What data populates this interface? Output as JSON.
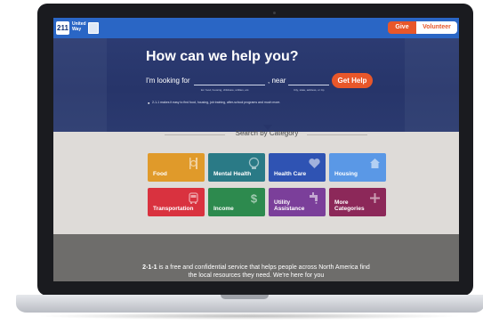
{
  "brand": {
    "logo_number": "211",
    "logo_name": "United Way"
  },
  "topbar": {
    "give_label": "Give",
    "volunteer_label": "Volunteer"
  },
  "hero": {
    "title": "How can we help you?",
    "looking_label": "I'm looking for",
    "near_label": ", near",
    "need_hint": "Ex: food, housing, childcare, utilities, etc.",
    "location_hint": "City, state, address, or zip",
    "button_label": "Get Help",
    "info_text": "2-1-1 makes it easy to find food, housing, job training, after-school programs and much more."
  },
  "categories": {
    "heading": "Search by Category",
    "items": [
      {
        "label": "Food",
        "color": "#e09a2a",
        "icon": "utensils-icon"
      },
      {
        "label": "Mental Health",
        "color": "#2a7a86",
        "icon": "head-icon"
      },
      {
        "label": "Health Care",
        "color": "#2f53b3",
        "icon": "heart-icon"
      },
      {
        "label": "Housing",
        "color": "#5a98e6",
        "icon": "house-icon"
      },
      {
        "label": "Transportation",
        "color": "#d9323f",
        "icon": "bus-icon"
      },
      {
        "label": "Income",
        "color": "#2d8a4e",
        "icon": "dollar-icon"
      },
      {
        "label": "Utility\nAssistance",
        "color": "#7b3f9a",
        "icon": "faucet-icon"
      },
      {
        "label": "More\nCategories",
        "color": "#8c2859",
        "icon": "plus-icon"
      }
    ]
  },
  "footer": {
    "lead": "2-1-1",
    "text": " is a free and confidential service that helps people across North America find the local resources they need. We're here for you"
  }
}
